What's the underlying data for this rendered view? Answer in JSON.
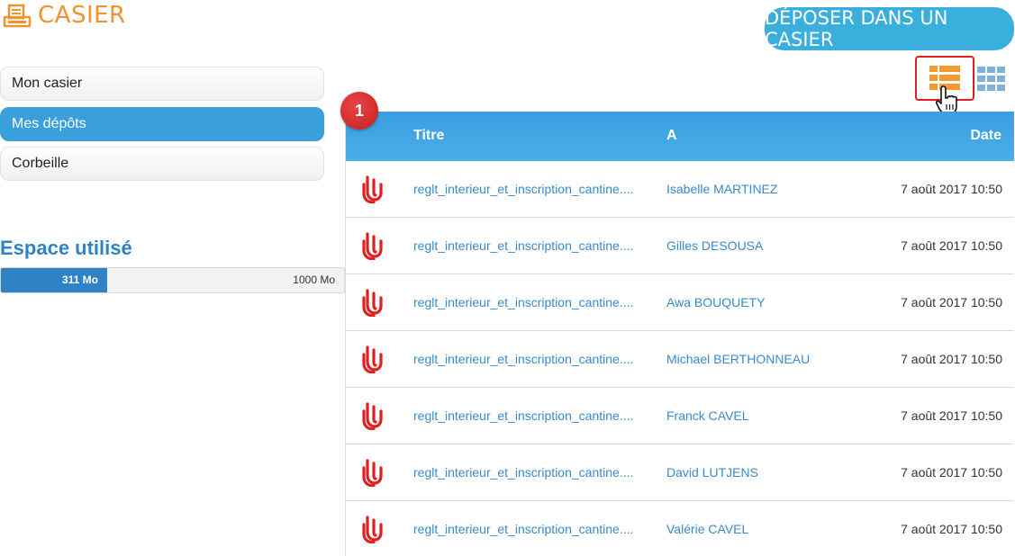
{
  "header": {
    "app_title": "CASIER",
    "deposit_button": "DÉPOSER DANS UN CASIER"
  },
  "sidebar": {
    "items": [
      {
        "label": "Mon casier",
        "active": false
      },
      {
        "label": "Mes dépôts",
        "active": true
      },
      {
        "label": "Corbeille",
        "active": false
      }
    ],
    "usage": {
      "title": "Espace utilisé",
      "used_label": "311 Mo",
      "total_label": "1000 Mo",
      "used_fraction": 0.311
    }
  },
  "step_badge": "1",
  "table": {
    "columns": {
      "title": "Titre",
      "to": "A",
      "date": "Date"
    },
    "rows": [
      {
        "title": "reglt_interieur_et_inscription_cantine....",
        "to": "Isabelle MARTINEZ",
        "date": "7 août 2017 10:50"
      },
      {
        "title": "reglt_interieur_et_inscription_cantine....",
        "to": "Gilles DESOUSA",
        "date": "7 août 2017 10:50"
      },
      {
        "title": "reglt_interieur_et_inscription_cantine....",
        "to": "Awa BOUQUETY",
        "date": "7 août 2017 10:50"
      },
      {
        "title": "reglt_interieur_et_inscription_cantine....",
        "to": "Michael BERTHONNEAU",
        "date": "7 août 2017 10:50"
      },
      {
        "title": "reglt_interieur_et_inscription_cantine....",
        "to": "Franck CAVEL",
        "date": "7 août 2017 10:50"
      },
      {
        "title": "reglt_interieur_et_inscription_cantine....",
        "to": "David LUTJENS",
        "date": "7 août 2017 10:50"
      },
      {
        "title": "reglt_interieur_et_inscription_cantine....",
        "to": "Valérie CAVEL",
        "date": "7 août 2017 10:50"
      }
    ]
  },
  "icons": {
    "app_logo": "printer-tray-icon",
    "file": "pdf-file-icon",
    "view_list": "list-view-icon",
    "view_grid": "grid-view-icon",
    "cursor": "hand-pointer-icon"
  },
  "colors": {
    "accent_orange": "#f0922e",
    "primary_blue": "#3aaedd",
    "active_blue": "#3aa0dc",
    "link_blue": "#3a8ac8",
    "pdf_red": "#e02020"
  }
}
